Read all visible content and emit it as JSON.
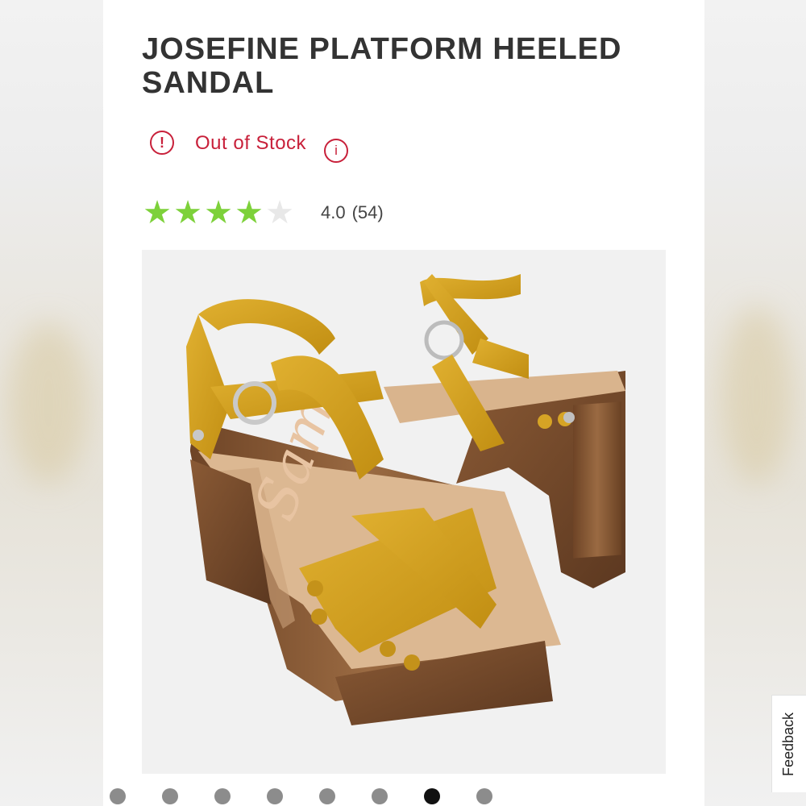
{
  "product": {
    "title": "JOSEFINE PLATFORM HEELED SANDAL",
    "stock_status": "Out of Stock",
    "stock_icon": "!",
    "info_icon": "i",
    "rating_value": "4.0",
    "rating_count": "(54)",
    "rating_stars": 4,
    "rating_max": 5
  },
  "gallery": {
    "image_count": 8,
    "active_index": 6
  },
  "feedback_label": "Feedback",
  "colors": {
    "accent_red": "#c8203a",
    "star_green": "#7dd13a",
    "mustard_suede": "#d4a21f",
    "wood": "#8a5a35"
  }
}
